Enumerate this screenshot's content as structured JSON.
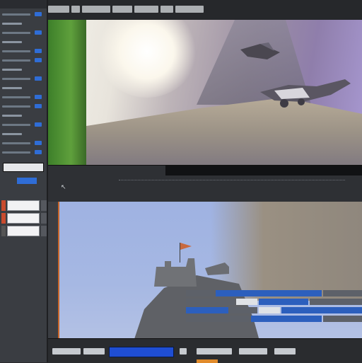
{
  "window": {
    "title": ""
  },
  "toolbar": {
    "labels": [
      "",
      ""
    ]
  },
  "top_viewport": {
    "name": "game-view"
  },
  "mid_panel": {
    "label_left": "",
    "label_right": "",
    "hint_top": "",
    "hint_bottom": ""
  },
  "bottom_viewport": {
    "name": "scene-view"
  },
  "status_bar": {
    "field_value": "",
    "buttons": [
      "",
      "",
      "",
      "",
      ""
    ]
  },
  "colors": {
    "accent_blue": "#2f6dd6",
    "accent_orange": "#e08a2a",
    "panel_bg": "#3a3d42",
    "sky_top": "#9fb2e2"
  },
  "icons": [
    "cursor-arrow-icon",
    "flag-icon"
  ]
}
